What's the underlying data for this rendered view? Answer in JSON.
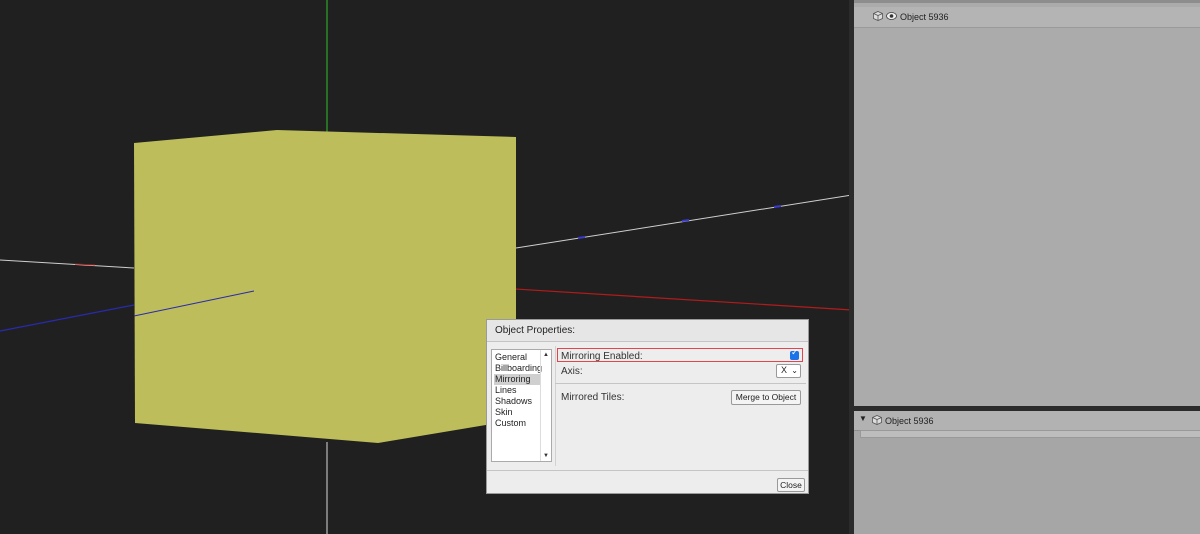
{
  "viewport": {
    "cube_color": "#bdbd5b",
    "axis_colors": {
      "x": "#b31b1b",
      "y": "#2da52d",
      "z": "#2a2ab0",
      "grid": "#d8d8d8"
    }
  },
  "outliner": {
    "top_item": {
      "label": "Object 5936",
      "icons": [
        "cube-icon",
        "eye-icon"
      ]
    },
    "bottom_item": {
      "label": "Object 5936",
      "icons": [
        "expand-triangle-icon",
        "cube-icon"
      ]
    }
  },
  "dialog": {
    "title": "Object Properties:",
    "tabs": [
      "General",
      "Billboarding",
      "Mirroring",
      "Lines",
      "Shadows",
      "Skin",
      "Custom"
    ],
    "selected_tab": "Mirroring",
    "mirroring_enabled_label": "Mirroring Enabled:",
    "mirroring_enabled": true,
    "axis_label": "Axis:",
    "axis_value": "X",
    "mirrored_tiles_label": "Mirrored Tiles:",
    "merge_button": "Merge to Object",
    "close_button": "Close"
  }
}
